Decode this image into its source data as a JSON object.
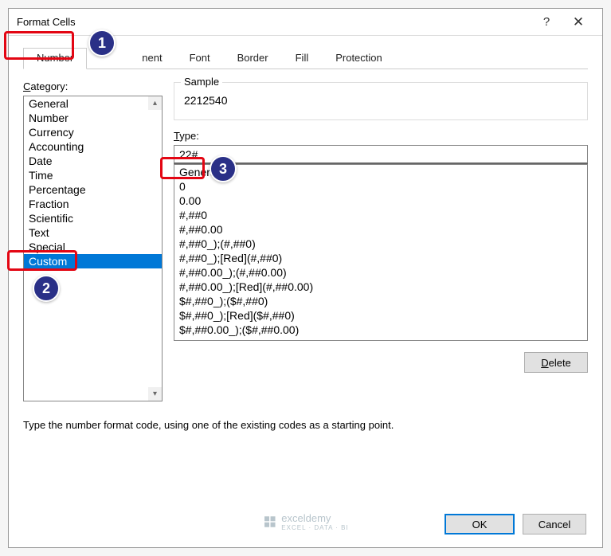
{
  "window": {
    "title": "Format Cells",
    "help": "?",
    "close": "✕"
  },
  "tabs": {
    "number": "Number",
    "alignment": "nent",
    "font": "Font",
    "border": "Border",
    "fill": "Fill",
    "protection": "Protection"
  },
  "category": {
    "label_prefix": "C",
    "label_rest": "ategory:",
    "items": [
      "General",
      "Number",
      "Currency",
      "Accounting",
      "Date",
      "Time",
      "Percentage",
      "Fraction",
      "Scientific",
      "Text",
      "Special",
      "Custom"
    ],
    "selected_index": 11
  },
  "sample": {
    "label": "Sample",
    "value": "2212540"
  },
  "type": {
    "label_prefix": "T",
    "label_rest": "ype:",
    "value": "22#",
    "items": [
      "General",
      "0",
      "0.00",
      "#,##0",
      "#,##0.00",
      "#,##0_);(#,##0)",
      "#,##0_);[Red](#,##0)",
      "#,##0.00_);(#,##0.00)",
      "#,##0.00_);[Red](#,##0.00)",
      "$#,##0_);($#,##0)",
      "$#,##0_);[Red]($#,##0)",
      "$#,##0.00_);($#,##0.00)"
    ]
  },
  "buttons": {
    "delete_prefix": "D",
    "delete_rest": "elete",
    "ok": "OK",
    "cancel": "Cancel"
  },
  "helptext": "Type the number format code, using one of the existing codes as a starting point.",
  "watermark": {
    "name": "exceldemy",
    "sub": "EXCEL · DATA · BI"
  },
  "annotations": {
    "n1": "1",
    "n2": "2",
    "n3": "3"
  }
}
